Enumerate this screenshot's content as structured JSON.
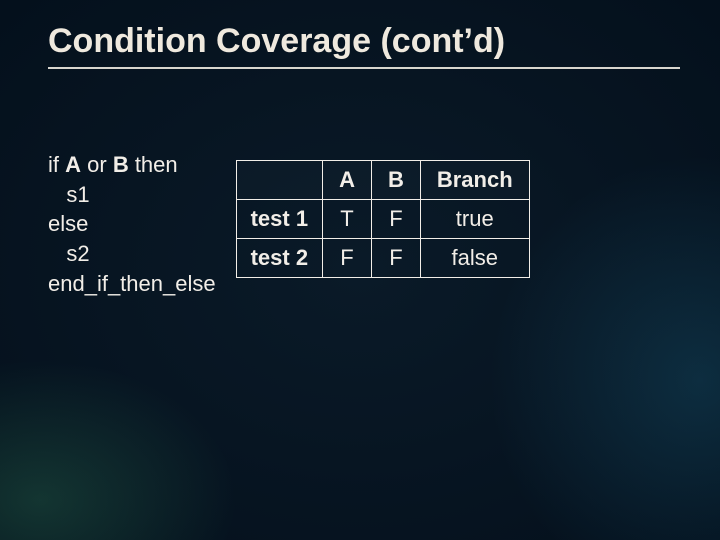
{
  "title": "Condition Coverage (cont’d)",
  "code": {
    "l0a": "if ",
    "l0b": "A",
    "l0c": " or ",
    "l0d": "B",
    "l0e": " then",
    "l1": "   s1",
    "l2": "else",
    "l3": "   s2",
    "l4": "end_if_then_else"
  },
  "table": {
    "head": {
      "c0": "",
      "c1": "A",
      "c2": "B",
      "c3": "Branch"
    },
    "rows": [
      {
        "name": "test 1",
        "a": "T",
        "b": "F",
        "branch": "true"
      },
      {
        "name": "test 2",
        "a": "F",
        "b": "F",
        "branch": "false"
      }
    ]
  }
}
